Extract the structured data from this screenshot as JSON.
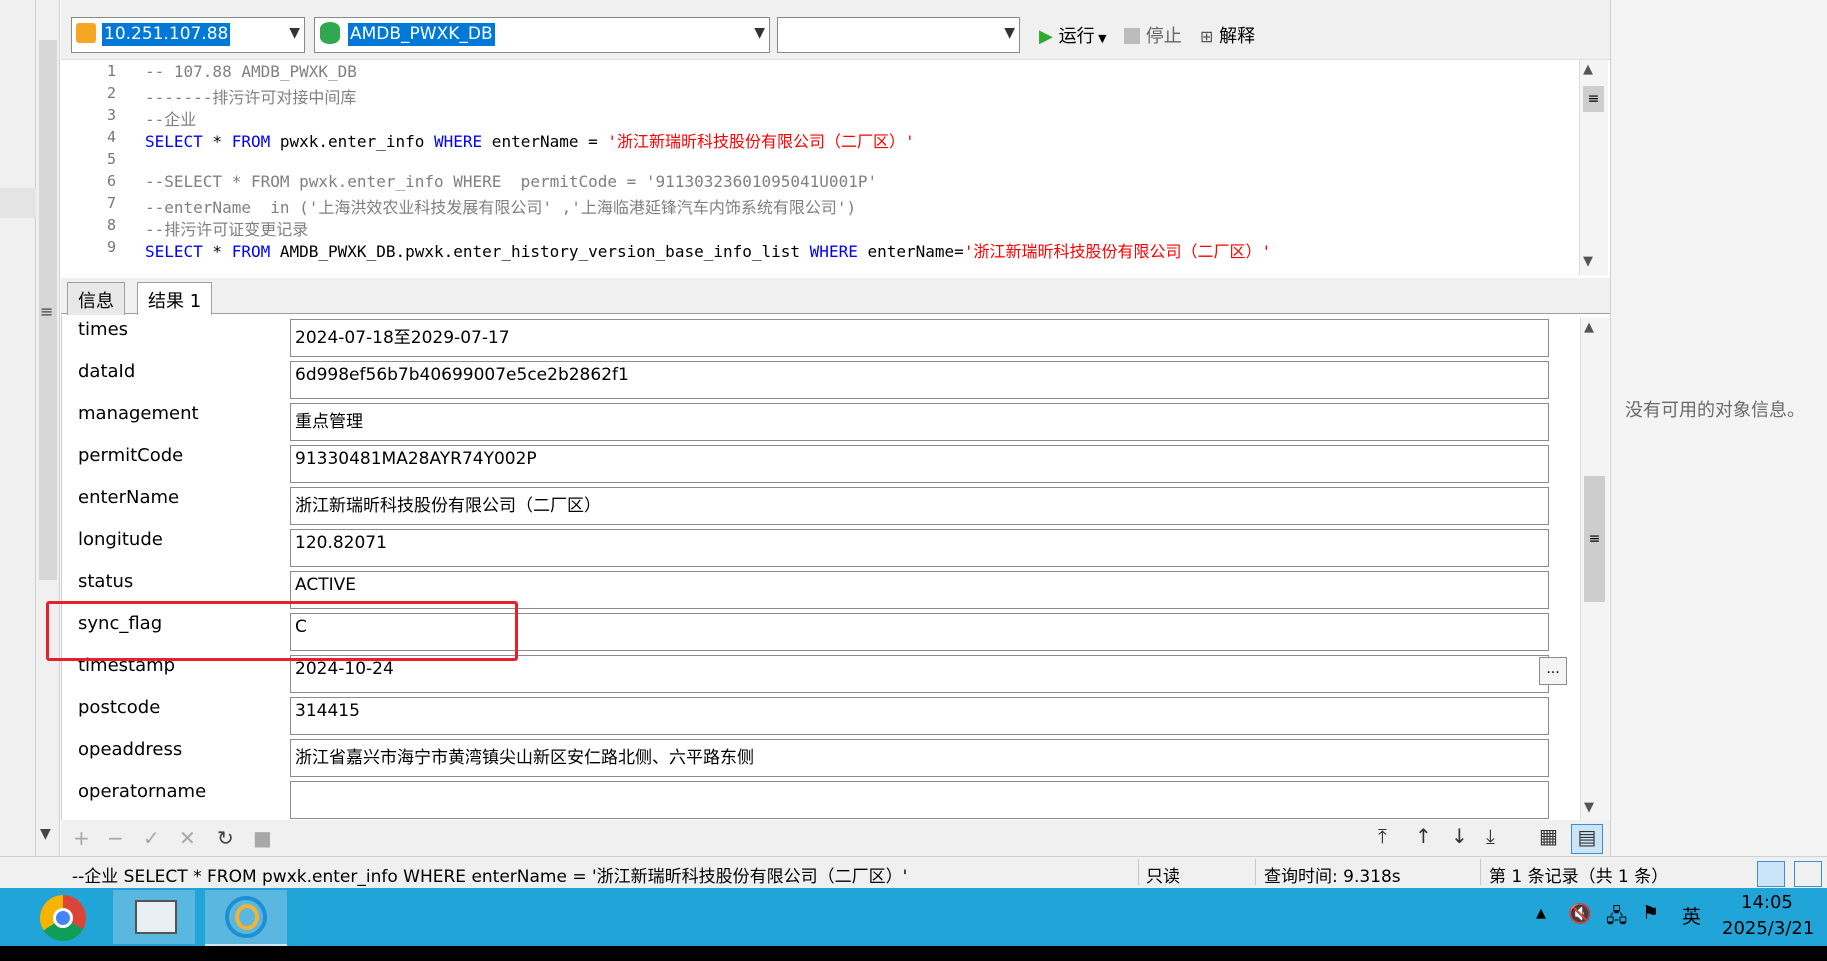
{
  "toolbar": {
    "connection": "10.251.107.88",
    "database": "AMDB_PWXK_DB",
    "schema": "",
    "run_label": "运行",
    "stop_label": "停止",
    "explain_label": "解释"
  },
  "editor": {
    "lines": [
      {
        "num": "1",
        "text": "-- 107.88 AMDB_PWXK_DB"
      },
      {
        "num": "2",
        "text": "-------排污许可对接中间库"
      },
      {
        "num": "3",
        "text": "--企业"
      },
      {
        "num": "4",
        "kw1": "SELECT",
        "t1": " * ",
        "kw2": "FROM",
        "t2": " pwxk.enter_info ",
        "kw3": "WHERE",
        "t3": " enterName = ",
        "str": "'浙江新瑞昕科技股份有限公司（二厂区）'"
      },
      {
        "num": "5",
        "text": ""
      },
      {
        "num": "6",
        "text": "--SELECT * FROM pwxk.enter_info WHERE  permitCode = '91130323601095041U001P'"
      },
      {
        "num": "7",
        "text": "--enterName  in ('上海洪效农业科技发展有限公司' ,'上海临港延锋汽车内饰系统有限公司')"
      },
      {
        "num": "8",
        "text": "--排污许可证变更记录"
      },
      {
        "num": "9",
        "kw1": "SELECT",
        "t1": " * ",
        "kw2": "FROM",
        "t2": " AMDB_PWXK_DB.pwxk.enter_history_version_base_info_list ",
        "kw3": "WHERE",
        "t3": " enterName=",
        "str": "'浙江新瑞昕科技股份有限公司（二厂区）'"
      }
    ]
  },
  "tabs": [
    {
      "label": "信息"
    },
    {
      "label": "结果 1"
    }
  ],
  "record": {
    "fields": [
      {
        "name": "times",
        "value": "2024-07-18至2029-07-17"
      },
      {
        "name": "dataId",
        "value": "6d998ef56b7b40699007e5ce2b2862f1"
      },
      {
        "name": "management",
        "value": "重点管理"
      },
      {
        "name": "permitCode",
        "value": "91330481MA28AYR74Y002P"
      },
      {
        "name": "enterName",
        "value": "浙江新瑞昕科技股份有限公司（二厂区）"
      },
      {
        "name": "longitude",
        "value": "120.82071"
      },
      {
        "name": "status",
        "value": "ACTIVE"
      },
      {
        "name": "sync_flag",
        "value": "C"
      },
      {
        "name": "timestamp",
        "value": "2024-10-24"
      },
      {
        "name": "postcode",
        "value": "314415"
      },
      {
        "name": "opeaddress",
        "value": "浙江省嘉兴市海宁市黄湾镇尖山新区安仁路北侧、六平路东侧"
      },
      {
        "name": "operatorname",
        "value": ""
      }
    ],
    "ellipsis": "..."
  },
  "status_bar": {
    "query": "--企业 SELECT * FROM pwxk.enter_info WHERE enterName = '浙江新瑞昕科技股份有限公司（二厂区）'",
    "mode": "只读",
    "query_time": "查询时间: 9.318s",
    "records": "第 1 条记录（共 1 条）"
  },
  "right_panel": {
    "message": "没有可用的对象信息。"
  },
  "taskbar": {
    "time": "14:05",
    "date": "2025/3/21",
    "ime": "英"
  },
  "colors": {
    "highlight": "#e8202a",
    "keyword": "#0000ff",
    "string": "#ff0000",
    "taskbar": "#21a4d8",
    "selection": "#0078d7"
  }
}
